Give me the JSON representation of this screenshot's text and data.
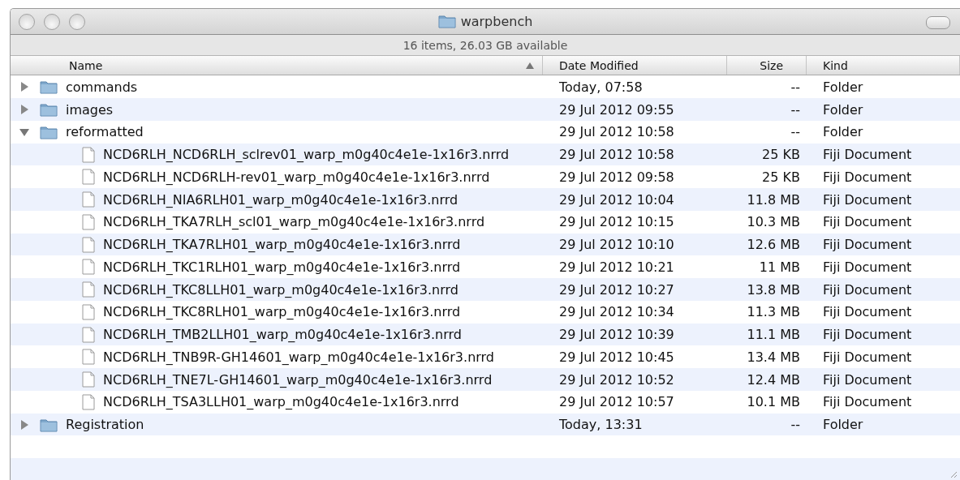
{
  "window": {
    "title": "warpbench"
  },
  "status_bar": "16 items, 26.03 GB available",
  "columns": [
    {
      "label": "Name",
      "sorted": true
    },
    {
      "label": "Date Modified",
      "sorted": false
    },
    {
      "label": "Size",
      "sorted": false
    },
    {
      "label": "Kind",
      "sorted": false
    }
  ],
  "rows": [
    {
      "kind": "folder",
      "name": "commands",
      "date": "Today, 07:58",
      "size": "--",
      "type": "Folder",
      "expanded": false
    },
    {
      "kind": "folder",
      "name": "images",
      "date": "29 Jul 2012 09:55",
      "size": "--",
      "type": "Folder",
      "expanded": false
    },
    {
      "kind": "folder",
      "name": "reformatted",
      "date": "29 Jul 2012 10:58",
      "size": "--",
      "type": "Folder",
      "expanded": true,
      "children": [
        {
          "kind": "file",
          "name": "NCD6RLH_NCD6RLH_sclrev01_warp_m0g40c4e1e-1x16r3.nrrd",
          "date": "29 Jul 2012 10:58",
          "size": "25 KB",
          "type": "Fiji Document"
        },
        {
          "kind": "file",
          "name": "NCD6RLH_NCD6RLH-rev01_warp_m0g40c4e1e-1x16r3.nrrd",
          "date": "29 Jul 2012 09:58",
          "size": "25 KB",
          "type": "Fiji Document"
        },
        {
          "kind": "file",
          "name": "NCD6RLH_NIA6RLH01_warp_m0g40c4e1e-1x16r3.nrrd",
          "date": "29 Jul 2012 10:04",
          "size": "11.8 MB",
          "type": "Fiji Document"
        },
        {
          "kind": "file",
          "name": "NCD6RLH_TKA7RLH_scl01_warp_m0g40c4e1e-1x16r3.nrrd",
          "date": "29 Jul 2012 10:15",
          "size": "10.3 MB",
          "type": "Fiji Document"
        },
        {
          "kind": "file",
          "name": "NCD6RLH_TKA7RLH01_warp_m0g40c4e1e-1x16r3.nrrd",
          "date": "29 Jul 2012 10:10",
          "size": "12.6 MB",
          "type": "Fiji Document"
        },
        {
          "kind": "file",
          "name": "NCD6RLH_TKC1RLH01_warp_m0g40c4e1e-1x16r3.nrrd",
          "date": "29 Jul 2012 10:21",
          "size": "11 MB",
          "type": "Fiji Document"
        },
        {
          "kind": "file",
          "name": "NCD6RLH_TKC8LLH01_warp_m0g40c4e1e-1x16r3.nrrd",
          "date": "29 Jul 2012 10:27",
          "size": "13.8 MB",
          "type": "Fiji Document"
        },
        {
          "kind": "file",
          "name": "NCD6RLH_TKC8RLH01_warp_m0g40c4e1e-1x16r3.nrrd",
          "date": "29 Jul 2012 10:34",
          "size": "11.3 MB",
          "type": "Fiji Document"
        },
        {
          "kind": "file",
          "name": "NCD6RLH_TMB2LLH01_warp_m0g40c4e1e-1x16r3.nrrd",
          "date": "29 Jul 2012 10:39",
          "size": "11.1 MB",
          "type": "Fiji Document"
        },
        {
          "kind": "file",
          "name": "NCD6RLH_TNB9R-GH14601_warp_m0g40c4e1e-1x16r3.nrrd",
          "date": "29 Jul 2012 10:45",
          "size": "13.4 MB",
          "type": "Fiji Document"
        },
        {
          "kind": "file",
          "name": "NCD6RLH_TNE7L-GH14601_warp_m0g40c4e1e-1x16r3.nrrd",
          "date": "29 Jul 2012 10:52",
          "size": "12.4 MB",
          "type": "Fiji Document"
        },
        {
          "kind": "file",
          "name": "NCD6RLH_TSA3LLH01_warp_m0g40c4e1e-1x16r3.nrrd",
          "date": "29 Jul 2012 10:57",
          "size": "10.1 MB",
          "type": "Fiji Document"
        }
      ]
    },
    {
      "kind": "folder",
      "name": "Registration",
      "date": "Today, 13:31",
      "size": "--",
      "type": "Folder",
      "expanded": false
    }
  ]
}
